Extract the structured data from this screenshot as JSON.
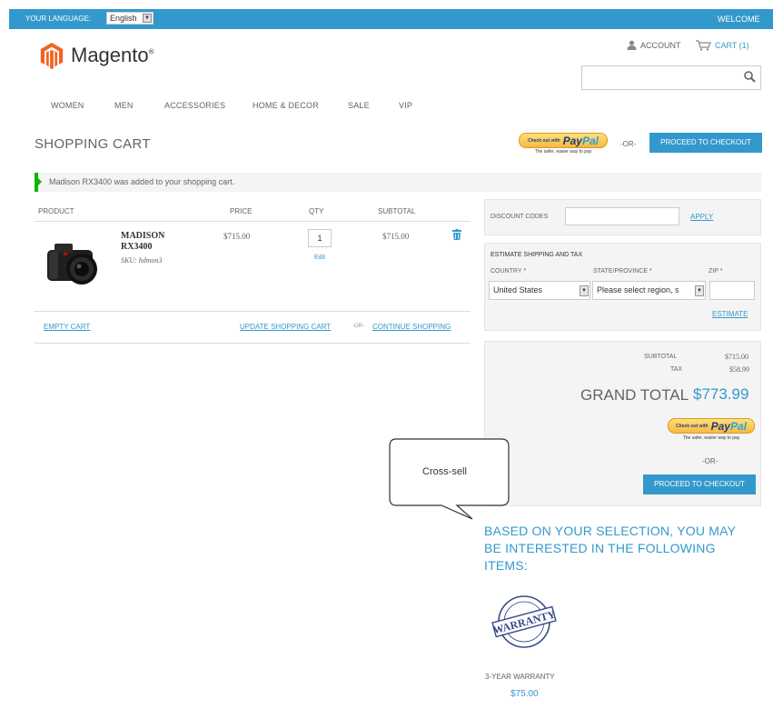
{
  "topbar": {
    "language_label": "YOUR LANGUAGE:",
    "language_value": "English",
    "welcome": "WELCOME"
  },
  "header": {
    "logo_text": "Magento",
    "logo_reg": "®",
    "account": "ACCOUNT",
    "cart": "CART (1)",
    "search_placeholder": ""
  },
  "nav": [
    "WOMEN",
    "MEN",
    "ACCESSORIES",
    "HOME & DECOR",
    "SALE",
    "VIP"
  ],
  "cart": {
    "title": "SHOPPING CART",
    "or": "-OR-",
    "checkout_label": "PROCEED TO CHECKOUT",
    "paypal_small": "Check out with",
    "paypal_logo_a": "Pay",
    "paypal_logo_b": "Pal",
    "paypal_tag": "The safer, easier way to pay",
    "message": "Madison RX3400 was added to your shopping cart.",
    "columns": [
      "PRODUCT",
      "PRICE",
      "QTY",
      "SUBTOTAL"
    ],
    "item": {
      "name": "MADISON RX3400",
      "sku": "SKU: hdmon3",
      "price": "$715.00",
      "qty": "1",
      "edit": "Edit",
      "subtotal": "$715.00"
    },
    "empty_cart": "EMPTY CART",
    "update_cart": "UPDATE SHOPPING CART",
    "or_small": "-OR-",
    "continue": "CONTINUE SHOPPING"
  },
  "discount": {
    "label": "DISCOUNT CODES",
    "value": "",
    "apply": "APPLY"
  },
  "shipping": {
    "title": "ESTIMATE SHIPPING AND TAX",
    "country_label": "COUNTRY",
    "country_value": "United States",
    "state_label": "STATE/PROVINCE",
    "state_value": "Please select region, s",
    "zip_label": "ZIP",
    "zip_value": "",
    "estimate": "ESTIMATE",
    "required_mark": "*"
  },
  "totals": {
    "subtotal_label": "SUBTOTAL",
    "subtotal_value": "$715.00",
    "tax_label": "TAX",
    "tax_value": "$58.99",
    "grand_label": "GRAND TOTAL",
    "grand_value": "$773.99",
    "or": "-OR-",
    "checkout_label": "PROCEED TO CHECKOUT"
  },
  "crosssell": {
    "callout": "Cross-sell",
    "title": "BASED ON YOUR SELECTION, YOU MAY BE INTERESTED IN THE FOLLOWING ITEMS:",
    "item_name": "3-YEAR WARRANTY",
    "item_price": "$75.00",
    "stamp_word": "WARRANTY"
  },
  "colors": {
    "accent": "#3399cc",
    "success": "#11b400",
    "text": "#636363"
  }
}
